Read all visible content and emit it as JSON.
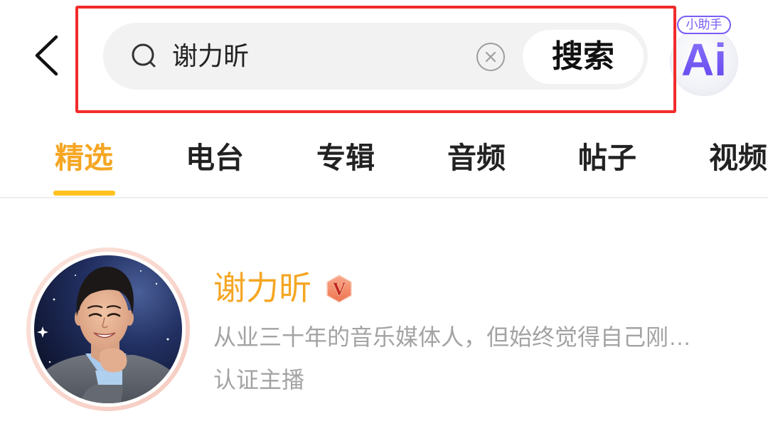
{
  "header": {
    "back_icon": "chevron-left-icon",
    "search": {
      "icon": "search-icon",
      "value": "谢力昕",
      "clear_icon": "clear-circle-icon",
      "button_label": "搜索"
    },
    "assistant": {
      "badge_label": "小助手",
      "logo_text": "Ai"
    }
  },
  "tabs": [
    {
      "label": "精选",
      "active": true
    },
    {
      "label": "电台",
      "active": false
    },
    {
      "label": "专辑",
      "active": false
    },
    {
      "label": "音频",
      "active": false
    },
    {
      "label": "帖子",
      "active": false
    },
    {
      "label": "视频",
      "active": false
    }
  ],
  "result": {
    "name": "谢力昕",
    "badge_label": "V",
    "description": "从业三十年的音乐媒体人，但始终觉得自己刚…",
    "tag": "认证主播"
  },
  "colors": {
    "accent": "#F5A623",
    "tab_underline": "#FFC21E",
    "highlight_border": "#F22B2B",
    "assistant_purple": "#7A5CF5",
    "muted_text": "#A3A3A3"
  }
}
